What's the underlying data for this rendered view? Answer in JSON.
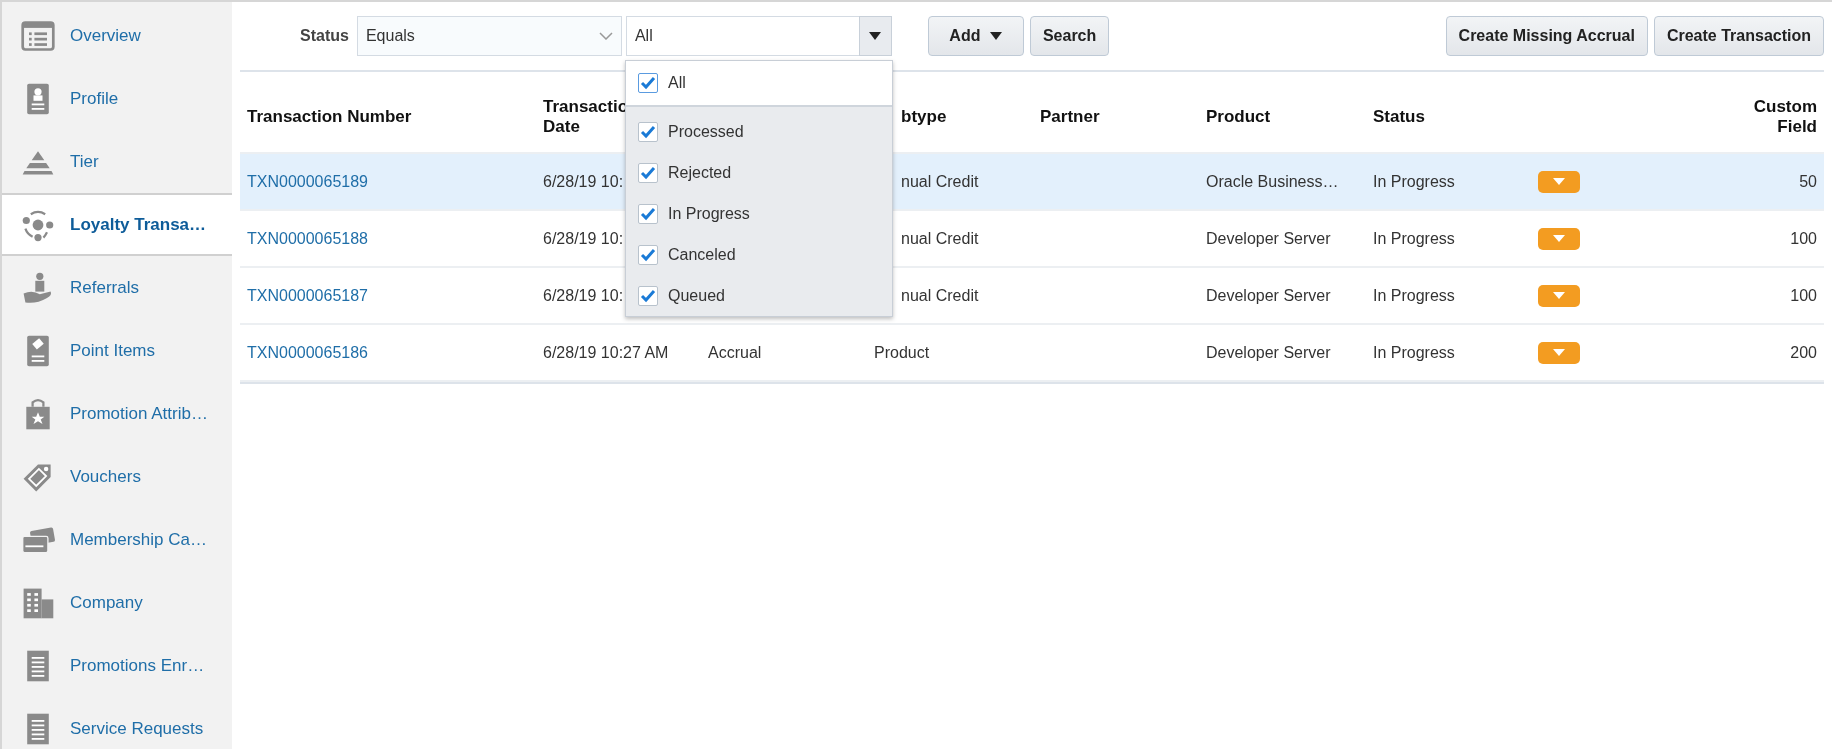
{
  "sidebar": {
    "items": [
      {
        "label": "Overview",
        "selected": false
      },
      {
        "label": "Profile",
        "selected": false
      },
      {
        "label": "Tier",
        "selected": false
      },
      {
        "label": "Loyalty Transa…",
        "selected": true
      },
      {
        "label": "Referrals",
        "selected": false
      },
      {
        "label": "Point Items",
        "selected": false
      },
      {
        "label": "Promotion Attrib…",
        "selected": false
      },
      {
        "label": "Vouchers",
        "selected": false
      },
      {
        "label": "Membership Ca…",
        "selected": false
      },
      {
        "label": "Company",
        "selected": false
      },
      {
        "label": "Promotions Enr…",
        "selected": false
      },
      {
        "label": "Service Requests",
        "selected": false
      }
    ]
  },
  "filter": {
    "label": "Status",
    "operator": "Equals",
    "value": "All"
  },
  "toolbar": {
    "add": "Add",
    "search": "Search",
    "actions": [
      "Create Missing Accrual",
      "Create Transaction"
    ]
  },
  "status_dropdown": {
    "open": true,
    "items": [
      {
        "kind": "all",
        "label": "All",
        "checked": true
      },
      {
        "kind": "option",
        "label": "Processed",
        "checked": true
      },
      {
        "kind": "option",
        "label": "Rejected",
        "checked": true
      },
      {
        "kind": "option",
        "label": "In Progress",
        "checked": true
      },
      {
        "kind": "option",
        "label": "Canceled",
        "checked": true
      },
      {
        "kind": "option",
        "label": "Queued",
        "checked": true
      }
    ]
  },
  "table": {
    "columns": [
      {
        "lines": [
          "Transaction Number"
        ]
      },
      {
        "lines": [
          "Transactio",
          "Date"
        ]
      },
      {},
      {
        "lines": [
          "btype"
        ]
      },
      {
        "lines": [
          "Partner"
        ]
      },
      {
        "lines": [
          "Product"
        ]
      },
      {
        "lines": [
          "Status"
        ]
      },
      {},
      {
        "lines": [
          "Custom",
          "Field"
        ]
      }
    ],
    "rows": [
      {
        "selected": true,
        "number": "TXN0000065189",
        "date": "6/28/19 10:",
        "subtype": "nual Credit",
        "product": "Oracle Business…",
        "status": "In Progress",
        "custom_field": "50"
      },
      {
        "selected": false,
        "number": "TXN0000065188",
        "date": "6/28/19 10:",
        "subtype": "nual Credit",
        "product": "Developer Server",
        "status": "In Progress",
        "custom_field": "100"
      },
      {
        "selected": false,
        "number": "TXN0000065187",
        "date": "6/28/19 10:",
        "subtype": "nual Credit",
        "product": "Developer Server",
        "status": "In Progress",
        "custom_field": "100"
      },
      {
        "selected": false,
        "number": "TXN0000065186",
        "date": "6/28/19 10:27 AM",
        "type": "Accrual",
        "subtype": "Product",
        "product": "Developer Server",
        "status": "In Progress",
        "custom_field": "200"
      }
    ]
  }
}
